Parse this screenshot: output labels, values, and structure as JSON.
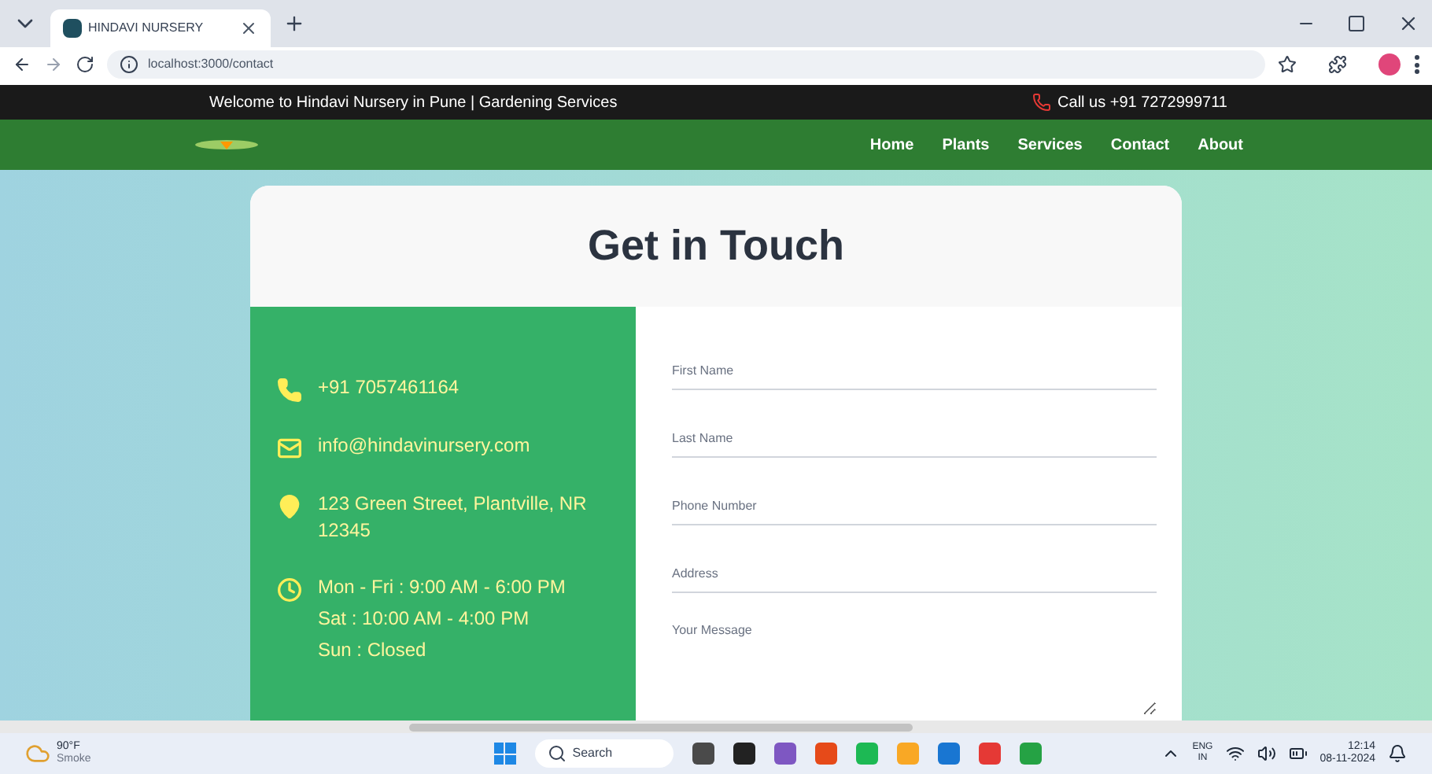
{
  "browser": {
    "tab_title": "HINDAVI NURSERY",
    "url": "localhost:3000/contact"
  },
  "topbar": {
    "welcome": "Welcome to Hindavi Nursery in Pune | Gardening Services",
    "call": "Call us +91 7272999711"
  },
  "nav": [
    {
      "label": "Home"
    },
    {
      "label": "Plants"
    },
    {
      "label": "Services"
    },
    {
      "label": "Contact"
    },
    {
      "label": "About"
    }
  ],
  "heading": "Get in Touch",
  "contact_info": [
    {
      "kind": "phone",
      "lines": [
        "+91 7057461164"
      ]
    },
    {
      "kind": "email",
      "lines": [
        "info@hindavinursery.com"
      ]
    },
    {
      "kind": "location",
      "lines": [
        "123 Green Street, Plantville, NR 12345"
      ]
    },
    {
      "kind": "hours",
      "lines": [
        "Mon - Fri : 9:00 AM - 6:00 PM",
        "Sat : 10:00 AM - 4:00 PM",
        "Sun : Closed"
      ]
    }
  ],
  "form_fields": [
    {
      "kind": "input",
      "placeholder": "First Name"
    },
    {
      "kind": "input",
      "placeholder": "Last Name"
    },
    {
      "kind": "input",
      "placeholder": "Phone Number"
    },
    {
      "kind": "input",
      "placeholder": "Address"
    },
    {
      "kind": "textarea",
      "placeholder": "Your Message"
    }
  ],
  "taskbar": {
    "weather_temp": "90°F",
    "weather_text": "Smoke",
    "search": "Search",
    "lang": "ENG",
    "region": "IN",
    "time": "12:14",
    "date": "08-11-2024"
  }
}
